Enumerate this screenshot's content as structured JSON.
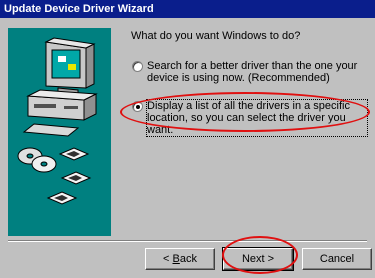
{
  "window": {
    "title": "Update Device Driver Wizard"
  },
  "question": "What do you want Windows to do?",
  "options": [
    {
      "line1": "Search for a better driver than the one your",
      "line2": "device is using now. (Recommended)",
      "selected": false
    },
    {
      "line1": "Display a list of all the drivers in a specific",
      "line2": "location, so you can select the driver you want.",
      "selected": true
    }
  ],
  "buttons": {
    "back_pre": "< ",
    "back_key": "B",
    "back_post": "ack",
    "next": "Next >",
    "cancel": "Cancel"
  },
  "icons": [
    "computer-icon",
    "cd-disc-icon",
    "floppy-disk-icon"
  ],
  "colors": {
    "title_bar": "#0a1e8c",
    "art_panel": "#008080",
    "annotation": "#e01010"
  }
}
